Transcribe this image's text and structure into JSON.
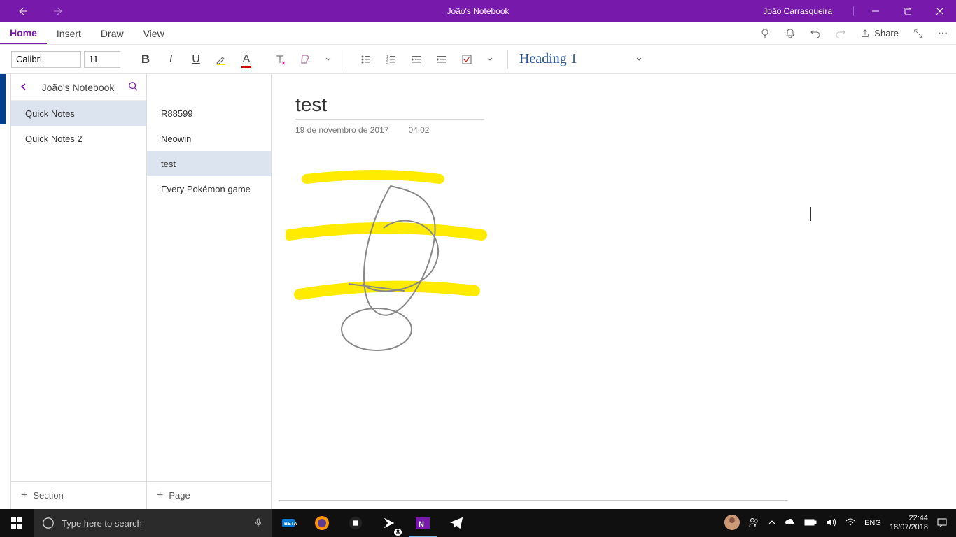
{
  "titlebar": {
    "title": "João's Notebook",
    "user": "João Carrasqueira"
  },
  "menu": {
    "tabs": [
      "Home",
      "Insert",
      "Draw",
      "View"
    ],
    "active": 0,
    "share": "Share"
  },
  "toolbar": {
    "font": "Calibri",
    "size": "11",
    "style": "Heading 1"
  },
  "nav": {
    "notebook": "João's Notebook",
    "sections": [
      "Quick Notes",
      "Quick Notes 2"
    ],
    "selected_section": 0,
    "pages": [
      "R88599",
      "Neowin",
      "test",
      "Every Pokémon game"
    ],
    "selected_page": 2,
    "add_section": "Section",
    "add_page": "Page"
  },
  "page": {
    "title": "test",
    "date": "19 de novembro de 2017",
    "time": "04:02"
  },
  "taskbar": {
    "search_placeholder": "Type here to search",
    "lang": "ENG",
    "time": "22:44",
    "date": "18/07/2018",
    "badge": "8"
  }
}
